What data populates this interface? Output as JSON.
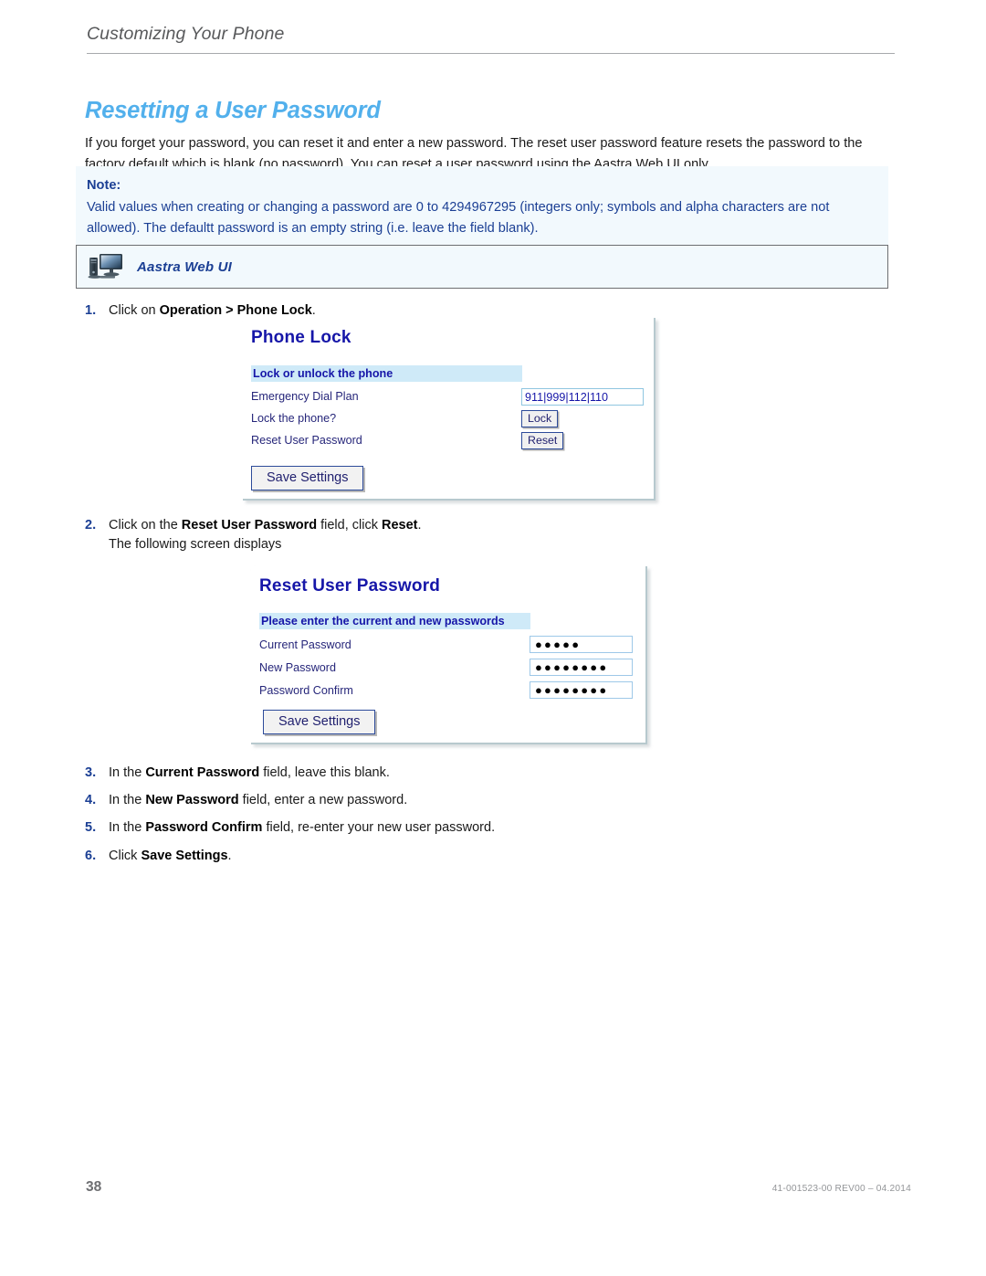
{
  "header": {
    "running_title": "Customizing Your Phone"
  },
  "section": {
    "title": "Resetting a User Password",
    "intro": "If you forget your password, you can reset it and enter a new password. The reset user password feature resets the password to the factory default which is blank (no password). You can reset a user password using the Aastra Web UI only."
  },
  "note": {
    "label": "Note:",
    "body": "Valid values when creating or changing a password are 0 to 4294967295 (integers only; symbols and alpha characters are not allowed). The defaultt password is an empty string (i.e. leave the field blank)."
  },
  "aastra_bar": {
    "label": "Aastra Web UI",
    "icon": "desktop-monitor-icon"
  },
  "steps": [
    {
      "num": "1.",
      "parts": [
        {
          "t": "Click on ",
          "b": false
        },
        {
          "t": "Operation > Phone Lock",
          "b": true
        },
        {
          "t": ".",
          "b": false
        }
      ]
    },
    {
      "num": "2.",
      "parts": [
        {
          "t": "Click on the ",
          "b": false
        },
        {
          "t": "Reset User Password",
          "b": true
        },
        {
          "t": " field, click ",
          "b": false
        },
        {
          "t": "Reset",
          "b": true
        },
        {
          "t": ".",
          "b": false
        },
        {
          "t": "\nThe following screen displays",
          "b": false
        }
      ]
    },
    {
      "num": "3.",
      "parts": [
        {
          "t": "In the ",
          "b": false
        },
        {
          "t": "Current Password",
          "b": true
        },
        {
          "t": " field, leave this blank.",
          "b": false
        }
      ]
    },
    {
      "num": "4.",
      "parts": [
        {
          "t": "In the ",
          "b": false
        },
        {
          "t": "New Password",
          "b": true
        },
        {
          "t": " field, enter a new password.",
          "b": false
        }
      ]
    },
    {
      "num": "5.",
      "parts": [
        {
          "t": "In the ",
          "b": false
        },
        {
          "t": "Password Confirm",
          "b": true
        },
        {
          "t": " field, re-enter your new user password.",
          "b": false
        }
      ]
    },
    {
      "num": "6.",
      "parts": [
        {
          "t": "Click ",
          "b": false
        },
        {
          "t": "Save Settings",
          "b": true
        },
        {
          "t": ".",
          "b": false
        }
      ]
    }
  ],
  "phone_lock_screen": {
    "title": "Phone Lock",
    "banner": "Lock or unlock the phone",
    "rows": [
      {
        "label": "Emergency Dial Plan",
        "control": "input",
        "value": "911|999|112|110"
      },
      {
        "label": "Lock the phone?",
        "control": "button",
        "value": "Lock"
      },
      {
        "label": "Reset User Password",
        "control": "button",
        "value": "Reset"
      }
    ],
    "save_button": "Save Settings"
  },
  "reset_password_screen": {
    "title": "Reset User Password",
    "banner": "Please enter the current and new passwords",
    "rows": [
      {
        "label": "Current Password",
        "value": "●●●●●"
      },
      {
        "label": "New Password",
        "value": "●●●●●●●●"
      },
      {
        "label": "Password Confirm",
        "value": "●●●●●●●●"
      }
    ],
    "save_button": "Save Settings"
  },
  "footer": {
    "page_number": "38",
    "doc_id": "41-001523-00 REV00 – 04.2014"
  },
  "colors": {
    "section_title": "#52b0ec",
    "note_text": "#1b3f94",
    "note_bg": "#f2f9fd",
    "webui_title": "#1616a8",
    "webui_banner_bg": "#cfeaf8",
    "footer_gray": "#939598"
  }
}
